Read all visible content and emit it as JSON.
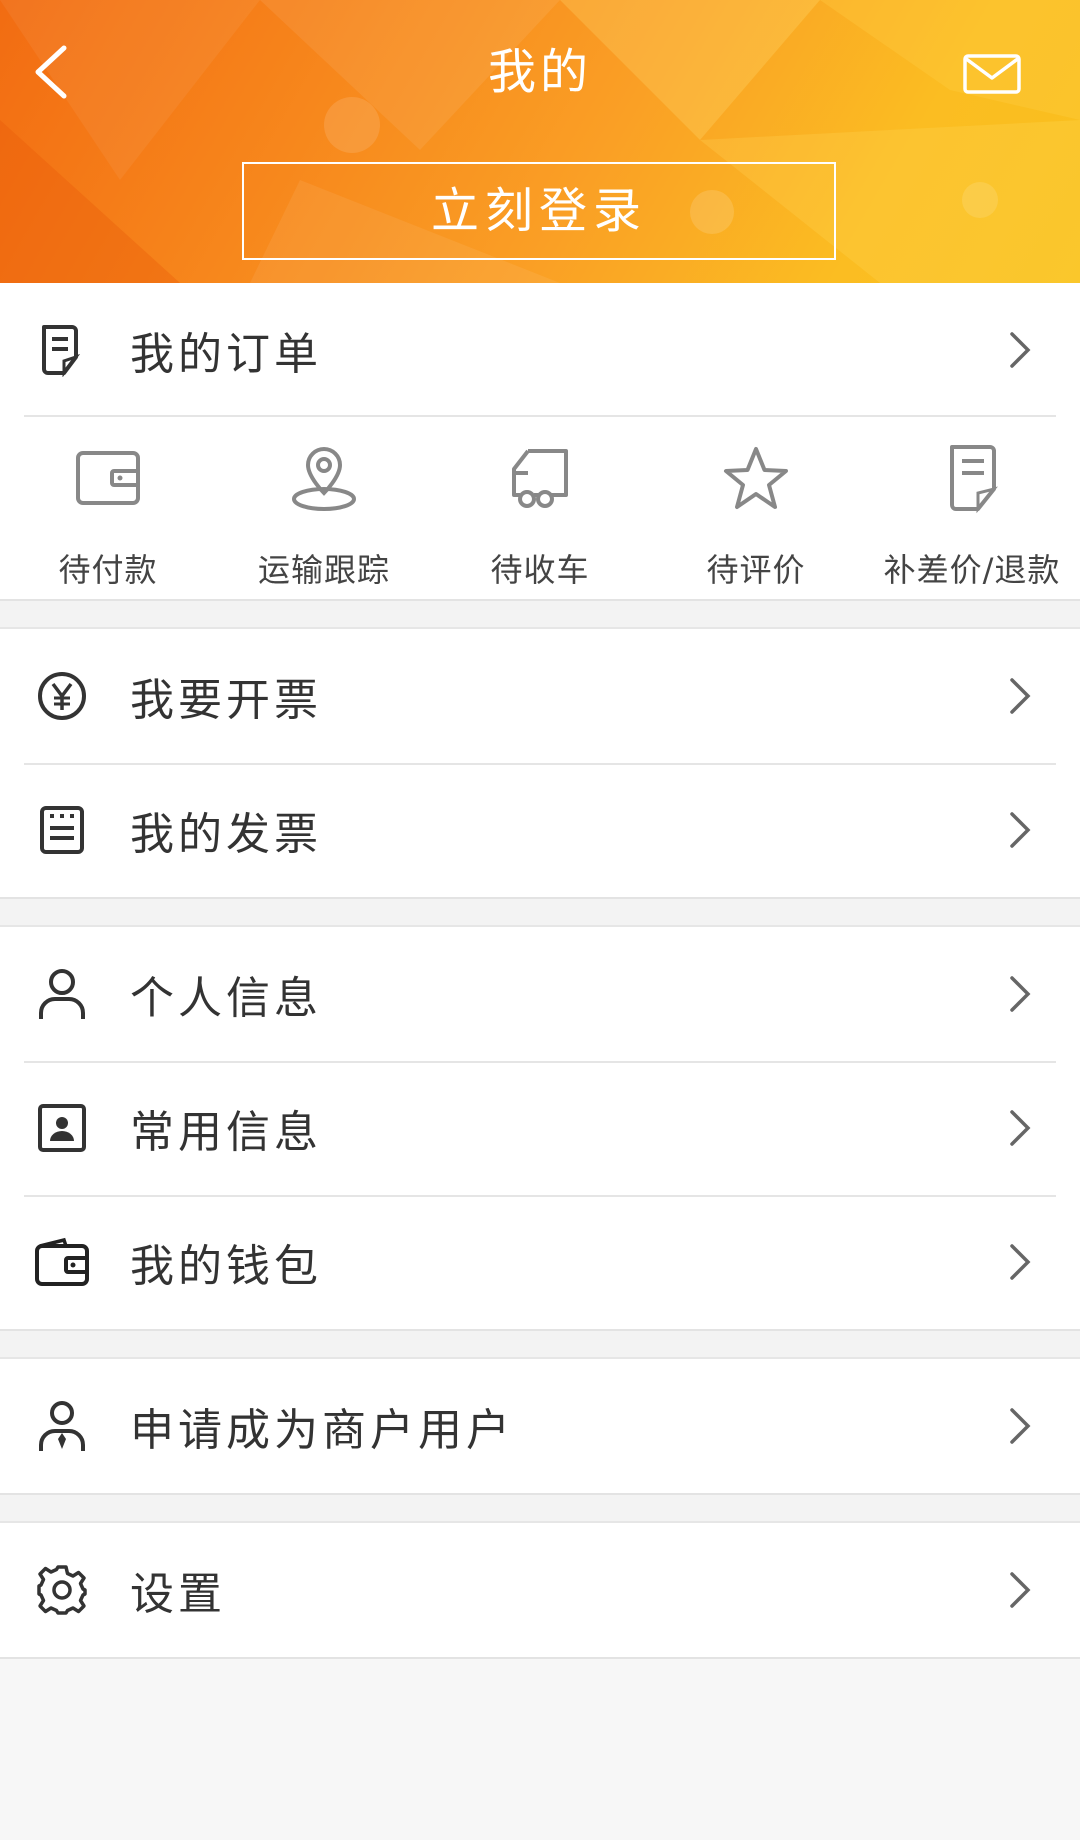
{
  "header": {
    "title": "我的",
    "back_icon": "chevron-left-icon",
    "mail_icon": "envelope-icon",
    "login_label": "立刻登录",
    "gradient_colors": [
      "#f26c12",
      "#fa9f25",
      "#f9c01c"
    ]
  },
  "orders": {
    "label": "我的订单",
    "icon": "order-document-icon",
    "statuses": [
      {
        "label": "待付款",
        "icon": "wallet-icon"
      },
      {
        "label": "运输跟踪",
        "icon": "location-pin-icon"
      },
      {
        "label": "待收车",
        "icon": "truck-icon"
      },
      {
        "label": "待评价",
        "icon": "star-icon"
      },
      {
        "label": "补差价/退款",
        "icon": "refund-document-icon"
      }
    ]
  },
  "invoice": {
    "request_label": "我要开票",
    "request_icon": "yen-circle-icon",
    "mine_label": "我的发票",
    "mine_icon": "invoice-list-icon"
  },
  "account": {
    "profile_label": "个人信息",
    "profile_icon": "user-icon",
    "common_label": "常用信息",
    "common_icon": "contact-card-icon",
    "wallet_label": "我的钱包",
    "wallet_icon": "wallet-icon"
  },
  "merchant": {
    "label": "申请成为商户用户",
    "icon": "business-user-icon"
  },
  "settings": {
    "label": "设置",
    "icon": "gear-icon"
  },
  "colors": {
    "accent": "#f7871c",
    "text": "#333333",
    "icon_gray": "#888888",
    "background": "#f7f7f7"
  }
}
